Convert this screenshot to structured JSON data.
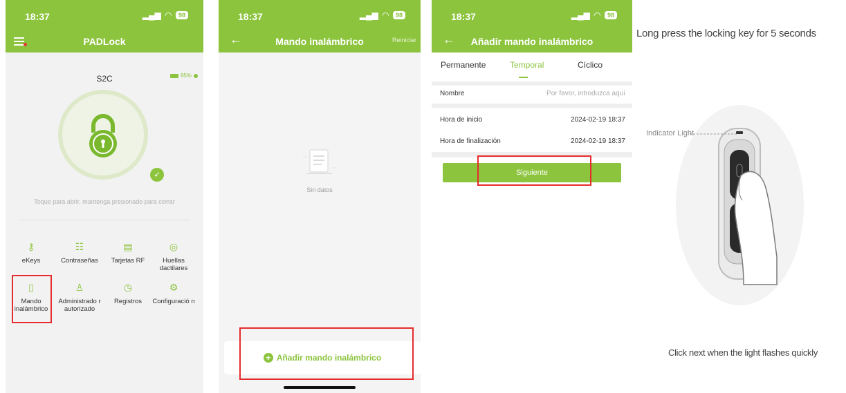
{
  "panel1": {
    "status": {
      "time": "18:37",
      "battery": "98"
    },
    "title": "PADLock",
    "device": {
      "name": "S2C",
      "battery_level": "95%"
    },
    "hint": "Toque para abrir, mantenga presionado para cerrar",
    "menu": [
      {
        "label": "eKeys",
        "icon": "key-icon"
      },
      {
        "label": "Contraseñas",
        "icon": "password-icon"
      },
      {
        "label": "Tarjetas RF",
        "icon": "rf-card-icon"
      },
      {
        "label": "Huellas dactilares",
        "icon": "fingerprint-icon"
      },
      {
        "label": "Mando inalámbrico",
        "icon": "remote-icon"
      },
      {
        "label": "Administrado r autorizado",
        "icon": "admin-icon"
      },
      {
        "label": "Registros",
        "icon": "history-icon"
      },
      {
        "label": "Configuració n",
        "icon": "gear-icon"
      }
    ]
  },
  "panel2": {
    "status": {
      "time": "18:37",
      "battery": "98"
    },
    "title": "Mando inalámbrico",
    "restart": "Reiniciar",
    "empty": "Sin datos",
    "add_button": "Añadir mando inalámbrico"
  },
  "panel3": {
    "status": {
      "time": "18:37",
      "battery": "98"
    },
    "title": "Añadir mando inalámbrico",
    "tabs": [
      "Permanente",
      "Temporal",
      "Cíclico"
    ],
    "fields": {
      "name_label": "Nombre",
      "name_placeholder": "Por favor, introduzca aquí",
      "start_label": "Hora de inicio",
      "start_value": "2024-02-19 18:37",
      "end_label": "Hora de finalización",
      "end_value": "2024-02-19 18:37"
    },
    "next_button": "Siguiente"
  },
  "panel4": {
    "top_text": "Long press the locking key for 5 seconds",
    "indicator_label": "Indicator Light",
    "bottom_text": "Click next when the light flashes quickly"
  },
  "colors": {
    "accent": "#8cc43d",
    "highlight": "#e52b2b"
  }
}
